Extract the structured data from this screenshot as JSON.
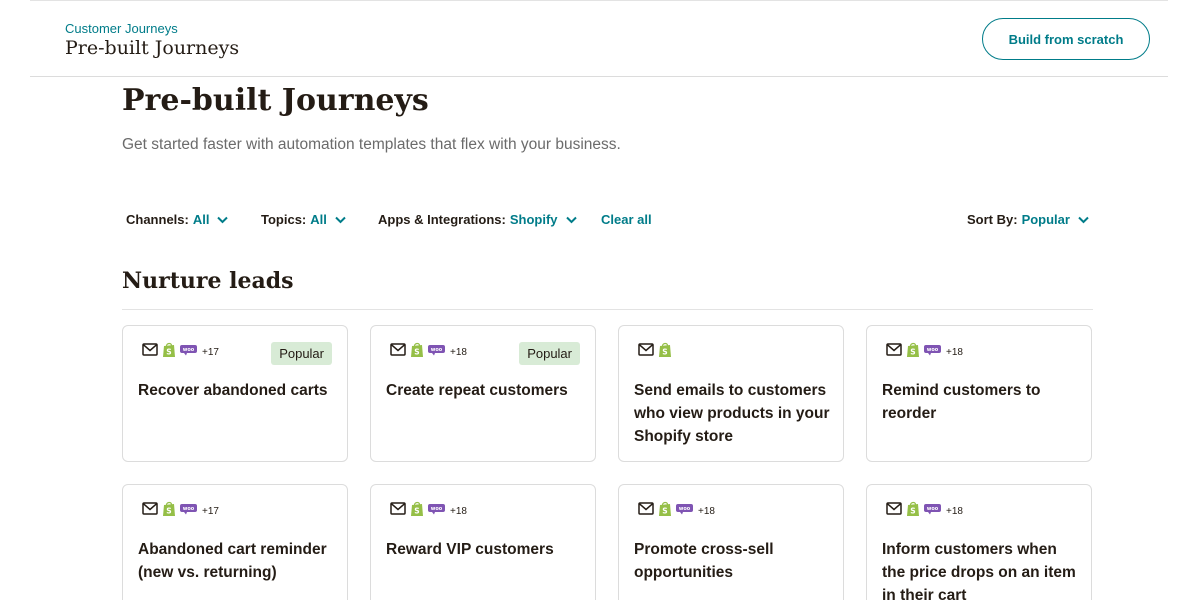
{
  "header": {
    "breadcrumb": "Customer Journeys",
    "title": "Pre-built Journeys",
    "build_button": "Build from scratch"
  },
  "main": {
    "title": "Pre-built Journeys",
    "subtitle": "Get started faster with automation templates that flex with your business."
  },
  "filters": {
    "channels_label": "Channels:",
    "channels_value": "All",
    "topics_label": "Topics:",
    "topics_value": "All",
    "apps_label": "Apps & Integrations:",
    "apps_value": "Shopify",
    "clear_all": "Clear all",
    "sort_label": "Sort By:",
    "sort_value": "Popular"
  },
  "section": {
    "title": "Nurture leads"
  },
  "cards": [
    {
      "title": "Recover abandoned carts",
      "more": "+17",
      "badge": "Popular",
      "icons": [
        "email-icon",
        "shopify-icon",
        "woo-icon"
      ]
    },
    {
      "title": "Create repeat customers",
      "more": "+18",
      "badge": "Popular",
      "icons": [
        "email-icon",
        "shopify-icon",
        "woo-icon"
      ]
    },
    {
      "title": "Send emails to customers who view products in your Shopify store",
      "more": "",
      "badge": "",
      "icons": [
        "email-icon",
        "shopify-icon"
      ]
    },
    {
      "title": "Remind customers to reorder",
      "more": "+18",
      "badge": "",
      "icons": [
        "email-icon",
        "shopify-icon",
        "woo-icon"
      ]
    },
    {
      "title": "Abandoned cart reminder (new vs. returning)",
      "more": "+17",
      "badge": "",
      "icons": [
        "email-icon",
        "shopify-icon",
        "woo-icon"
      ]
    },
    {
      "title": "Reward VIP customers",
      "more": "+18",
      "badge": "",
      "icons": [
        "email-icon",
        "shopify-icon",
        "woo-icon"
      ]
    },
    {
      "title": "Promote cross-sell opportunities",
      "more": "+18",
      "badge": "",
      "icons": [
        "email-icon",
        "shopify-icon",
        "woo-icon"
      ]
    },
    {
      "title": "Inform customers when the price drops on an item in their cart",
      "more": "+18",
      "badge": "",
      "icons": [
        "email-icon",
        "shopify-icon",
        "woo-icon"
      ]
    }
  ],
  "colors": {
    "accent": "#007c89",
    "badge_bg": "#d8ebd6",
    "shopify": "#95bf47",
    "woo": "#7f54b3"
  }
}
